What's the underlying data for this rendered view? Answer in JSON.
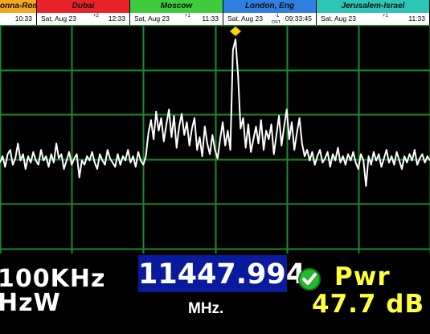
{
  "clocks": [
    {
      "city": "onna-Roma",
      "date": "",
      "offset": "",
      "dst": "",
      "time": "10:33",
      "color": "#f5a623"
    },
    {
      "city": "Dubai",
      "date": "Sat, Aug 23",
      "offset": "+2",
      "dst": "",
      "time": "12:33",
      "color": "#e8232a"
    },
    {
      "city": "Moscow",
      "date": "Sat, Aug 23",
      "offset": "+1",
      "dst": "",
      "time": "11:33",
      "color": "#3ecb3e"
    },
    {
      "city": "London, Eng",
      "date": "Sat, Aug 23",
      "offset": "-1",
      "dst": "DST",
      "time": "09:33:45",
      "color": "#2f7fe0"
    },
    {
      "city": "Jerusalem-Israel",
      "date": "Sat, Aug 23",
      "offset": "+1",
      "dst": "",
      "time": "11:33",
      "color": "#2ec4b6"
    }
  ],
  "spectrum": {
    "background": "#000000",
    "grid_color": "#1f8a2a",
    "trace_color": "#ffffff",
    "marker_color": "#ffd400",
    "trace": [
      0.61,
      0.58,
      0.63,
      0.57,
      0.55,
      0.62,
      0.59,
      0.52,
      0.6,
      0.57,
      0.64,
      0.58,
      0.61,
      0.56,
      0.6,
      0.62,
      0.55,
      0.6,
      0.58,
      0.63,
      0.57,
      0.61,
      0.52,
      0.59,
      0.57,
      0.64,
      0.6,
      0.56,
      0.62,
      0.59,
      0.57,
      0.68,
      0.6,
      0.62,
      0.58,
      0.6,
      0.56,
      0.61,
      0.64,
      0.57,
      0.6,
      0.62,
      0.55,
      0.59,
      0.61,
      0.63,
      0.57,
      0.62,
      0.58,
      0.6,
      0.55,
      0.61,
      0.58,
      0.63,
      0.56,
      0.6,
      0.62,
      0.58,
      0.47,
      0.41,
      0.5,
      0.37,
      0.46,
      0.4,
      0.51,
      0.43,
      0.36,
      0.49,
      0.39,
      0.54,
      0.44,
      0.38,
      0.48,
      0.42,
      0.53,
      0.45,
      0.4,
      0.55,
      0.49,
      0.58,
      0.44,
      0.52,
      0.57,
      0.48,
      0.55,
      0.59,
      0.5,
      0.42,
      0.53,
      0.46,
      0.55,
      0.08,
      0.03,
      0.2,
      0.45,
      0.4,
      0.54,
      0.43,
      0.56,
      0.5,
      0.44,
      0.52,
      0.41,
      0.55,
      0.46,
      0.5,
      0.43,
      0.57,
      0.48,
      0.39,
      0.53,
      0.44,
      0.36,
      0.5,
      0.42,
      0.55,
      0.47,
      0.4,
      0.52,
      0.58,
      0.55,
      0.6,
      0.56,
      0.62,
      0.58,
      0.55,
      0.61,
      0.59,
      0.56,
      0.63,
      0.57,
      0.6,
      0.54,
      0.61,
      0.58,
      0.62,
      0.57,
      0.6,
      0.56,
      0.61,
      0.64,
      0.57,
      0.6,
      0.72,
      0.58,
      0.62,
      0.56,
      0.6,
      0.57,
      0.63,
      0.59,
      0.55,
      0.61,
      0.58,
      0.62,
      0.56,
      0.6,
      0.64,
      0.58,
      0.61,
      0.57,
      0.6,
      0.55,
      0.62,
      0.59,
      0.57,
      0.61,
      0.58,
      0.6
    ]
  },
  "readout": {
    "span": "100KHz",
    "rbw": "HzW",
    "frequency": "11447.994",
    "frequency_unit": "MHz.",
    "lock_icon": "check-circle-icon",
    "power_label": "Pwr",
    "power_value": "47.7 dB"
  }
}
